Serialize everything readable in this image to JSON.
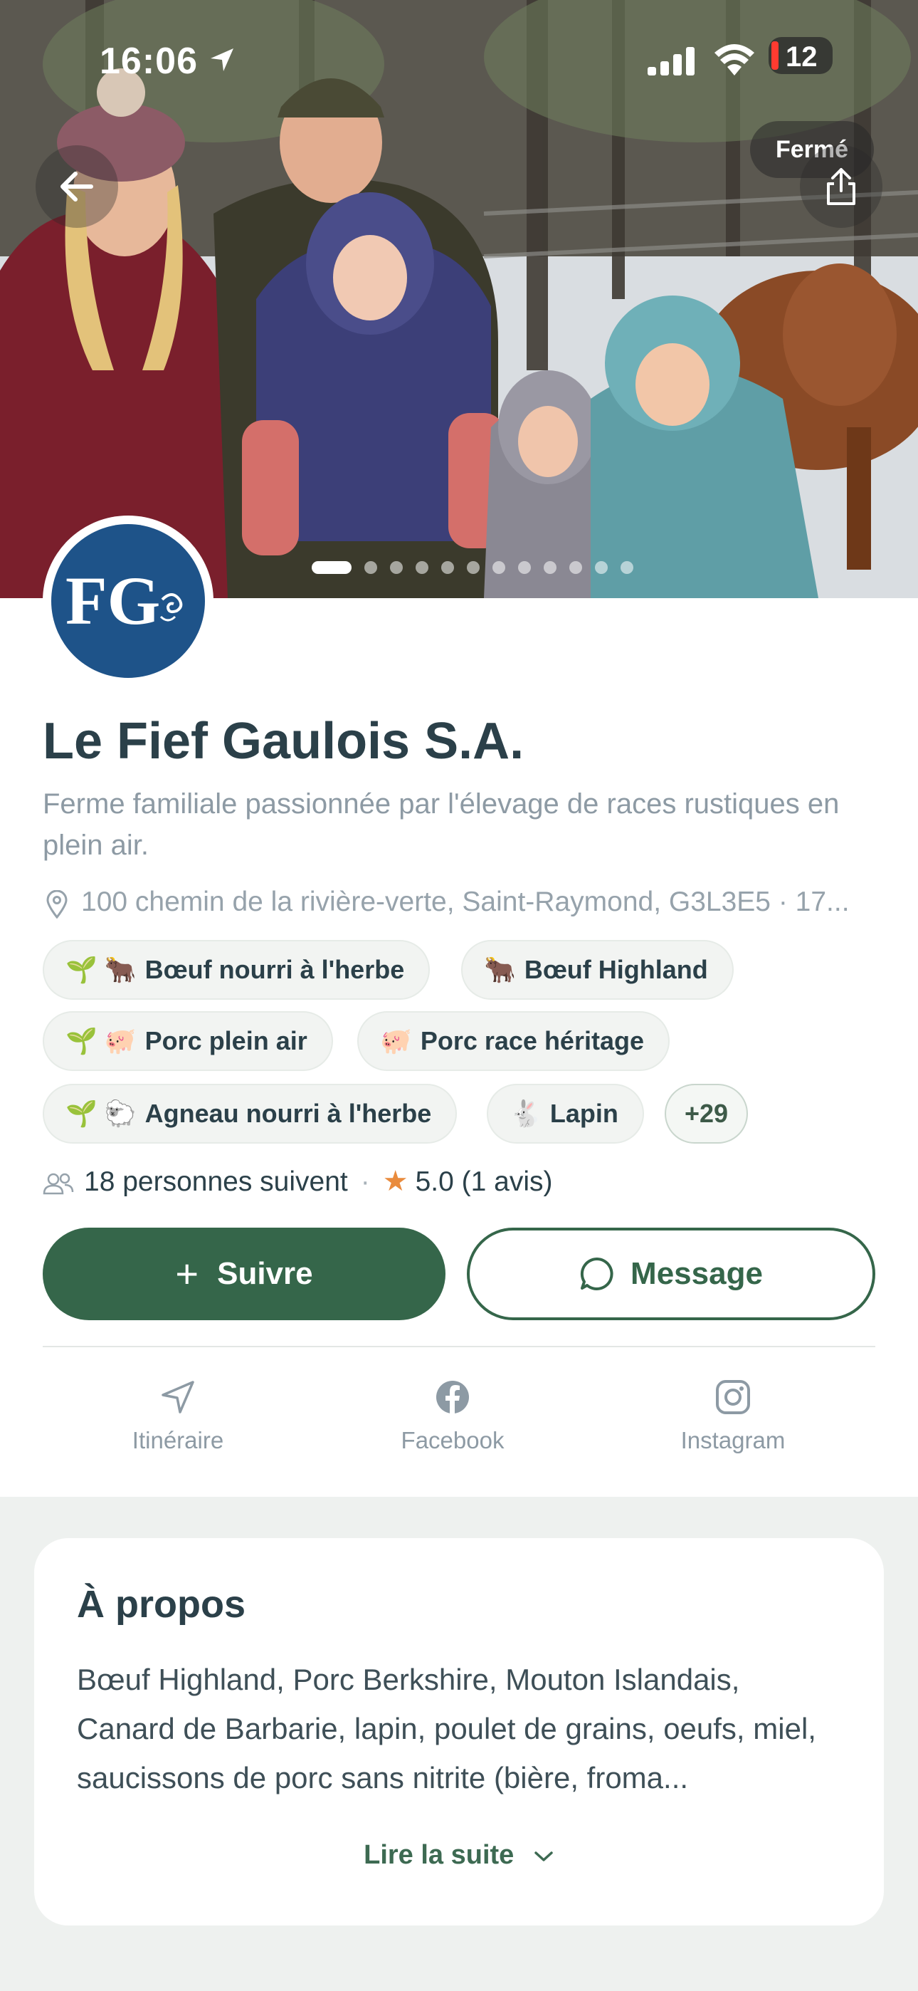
{
  "status_bar": {
    "time": "16:06",
    "battery": "12"
  },
  "hero": {
    "closed_label": "Fermé",
    "photo_count": 12,
    "active_photo": 1
  },
  "profile": {
    "logo_text": "FG",
    "name": "Le Fief Gaulois S.A.",
    "tagline": "Ferme familiale passionnée par l'élevage de races rustiques en plein air.",
    "address": "100 chemin de la rivière-verte, Saint-Raymond, G3L3E5 · 17..."
  },
  "tags": [
    {
      "emoji": "🌱 🐂",
      "label": "Bœuf nourri à l'herbe"
    },
    {
      "emoji": "🐂",
      "label": "Bœuf Highland"
    },
    {
      "emoji": "🌱 🐖",
      "label": "Porc plein air"
    },
    {
      "emoji": "🐖",
      "label": "Porc race héritage"
    },
    {
      "emoji": "🌱 🐑",
      "label": "Agneau nourri à l'herbe"
    },
    {
      "emoji": "🐇",
      "label": "Lapin"
    }
  ],
  "more_tags": "+29",
  "stats": {
    "followers": "18 personnes suivent",
    "separator": "·",
    "rating": "5.0 (1 avis)"
  },
  "actions": {
    "follow": "Suivre",
    "message": "Message"
  },
  "social": [
    {
      "icon": "navigation-arrow-icon",
      "label": "Itinéraire"
    },
    {
      "icon": "facebook-icon",
      "label": "Facebook"
    },
    {
      "icon": "instagram-icon",
      "label": "Instagram"
    }
  ],
  "about": {
    "title": "À propos",
    "text": "Bœuf Highland, Porc Berkshire, Mouton Islandais, Canard de Barbarie, lapin, poulet de grains, oeufs, miel, saucissons de porc sans nitrite (bière, froma...",
    "read_more": "Lire la suite"
  }
}
